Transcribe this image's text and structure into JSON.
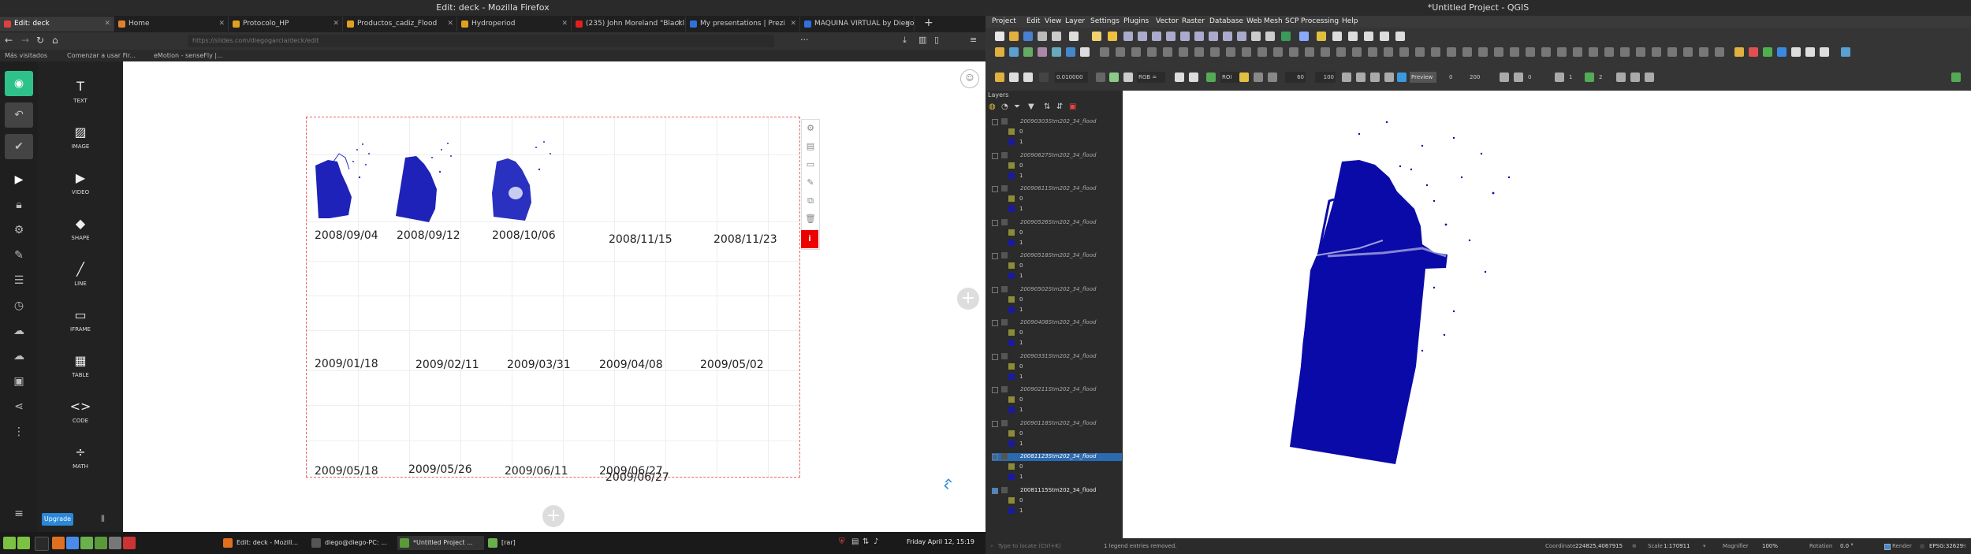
{
  "firefox": {
    "title": "Edit: deck - Mozilla Firefox",
    "tabs": [
      {
        "label": "Edit: deck",
        "color": "#e04040"
      },
      {
        "label": "Home",
        "color": "#e08030"
      },
      {
        "label": "Protocolo_HP",
        "color": "#e0a020"
      },
      {
        "label": "Productos_cadiz_Flood",
        "color": "#e0a020"
      },
      {
        "label": "Hydroperiod",
        "color": "#e0a020"
      },
      {
        "label": "(235) John Moreland \"Blackl...",
        "color": "#e02020"
      },
      {
        "label": "My presentations | Prezi",
        "color": "#3070e0"
      },
      {
        "label": "MAQUINA VIRTUAL by Diego...",
        "color": "#3070e0"
      }
    ],
    "url": "https://slides.com/diegogarcia/deck/edit",
    "bookmarks": [
      "Más visitados",
      "Comenzar a usar Fir...",
      "eMotion - senseFly |..."
    ]
  },
  "slides": {
    "tools": [
      "TEXT",
      "IMAGE",
      "VIDEO",
      "SHAPE",
      "LINE",
      "IFRAME",
      "TABLE",
      "CODE",
      "MATH"
    ],
    "upgrade": "Upgrade",
    "dates_row1": [
      "2008/09/04",
      "2008/09/12",
      "2008/10/06",
      "2008/11/15",
      "2008/11/23"
    ],
    "dates_row2": [
      "2009/01/18",
      "2009/02/11",
      "2009/03/31",
      "2009/04/08",
      "2009/05/02"
    ],
    "dates_row3": [
      "2009/05/18",
      "2009/05/26",
      "2009/06/11",
      "2009/06/27"
    ],
    "date_overlap": "2009/06/27"
  },
  "qgis": {
    "title": "*Untitled Project - QGIS",
    "menu": [
      "Project",
      "Edit",
      "View",
      "Layer",
      "Settings",
      "Plugins",
      "Vector",
      "Raster",
      "Database",
      "Web",
      "Mesh",
      "SCP",
      "Processing",
      "Help"
    ],
    "layers_title": "Layers",
    "toolbar_values": {
      "threshold": "0.010000",
      "mode": "RGB =",
      "roi": "ROI",
      "min": "60",
      "max": "100",
      "preview": "Preview",
      "n1": "0",
      "n2": "200",
      "n3": "0",
      "n4": "1",
      "n5": "2"
    },
    "layers": [
      {
        "name": "20090303Stm202_34_flood",
        "checked": false,
        "selected": false
      },
      {
        "name": "20090627Stm202_34_flood",
        "checked": false,
        "selected": false
      },
      {
        "name": "20090611Stm202_34_flood",
        "checked": false,
        "selected": false
      },
      {
        "name": "20090526Stm202_34_flood",
        "checked": false,
        "selected": false
      },
      {
        "name": "20090518Stm202_34_flood",
        "checked": false,
        "selected": false
      },
      {
        "name": "20090502Stm202_34_flood",
        "checked": false,
        "selected": false
      },
      {
        "name": "20090408Stm202_34_flood",
        "checked": false,
        "selected": false
      },
      {
        "name": "20090331Stm202_34_flood",
        "checked": false,
        "selected": false
      },
      {
        "name": "20090211Stm202_34_flood",
        "checked": false,
        "selected": false
      },
      {
        "name": "20090118Stm202_34_flood",
        "checked": false,
        "selected": false
      },
      {
        "name": "20081123Stm202_34_flood",
        "checked": false,
        "selected": true
      },
      {
        "name": "20081115Stm202_34_flood",
        "checked": true,
        "selected": false
      }
    ],
    "legend_values": [
      "0",
      "1"
    ],
    "legend_colors": [
      "#8b8b3a",
      "#1a1aa0"
    ],
    "status": {
      "locate": "Type to locate (Ctrl+K)",
      "info": "1 legend entries removed.",
      "coordinate_label": "Coordinate",
      "coordinate": "224825,4067915",
      "scale_label": "Scale",
      "scale": "1:170911",
      "magnifier_label": "Magnifier",
      "magnifier": "100%",
      "rotation_label": "Rotation",
      "rotation": "0.0 °",
      "render": "Render",
      "crs": "EPSG:32629"
    }
  },
  "taskbar": {
    "tasks": [
      "Edit: deck - Mozill...",
      "diego@diego-PC: ...",
      "*Untitled Project ...",
      "[rar]"
    ],
    "clock": "Friday April 12, 15:19"
  }
}
